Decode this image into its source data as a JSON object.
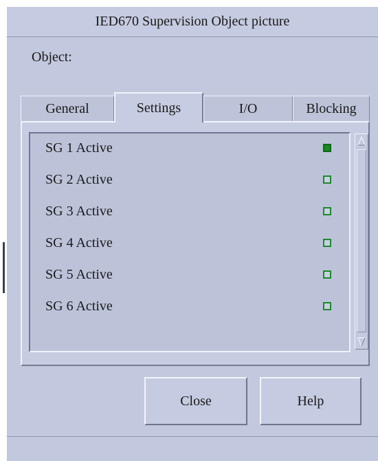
{
  "window": {
    "title": "IED670 Supervision Object picture",
    "object_label": "Object:"
  },
  "tabs": [
    {
      "label": "General",
      "active": false
    },
    {
      "label": "Settings",
      "active": true
    },
    {
      "label": "I/O",
      "active": false
    },
    {
      "label": "Blocking",
      "active": false
    }
  ],
  "settings": {
    "items": [
      {
        "label": "SG 1 Active",
        "active": true
      },
      {
        "label": "SG 2 Active",
        "active": false
      },
      {
        "label": "SG 3 Active",
        "active": false
      },
      {
        "label": "SG 4 Active",
        "active": false
      },
      {
        "label": "SG 5 Active",
        "active": false
      },
      {
        "label": "SG 6 Active",
        "active": false
      }
    ]
  },
  "buttons": {
    "close_label": "Close",
    "help_label": "Help"
  },
  "icons": {
    "scroll_up": "scroll-up-arrow-icon",
    "scroll_down": "scroll-down-arrow-icon",
    "indicator_on": "filled-square-indicator-icon",
    "indicator_off": "empty-square-indicator-icon"
  },
  "colors": {
    "window_bg": "#c2c8dd",
    "indicator_green": "#178a22"
  }
}
